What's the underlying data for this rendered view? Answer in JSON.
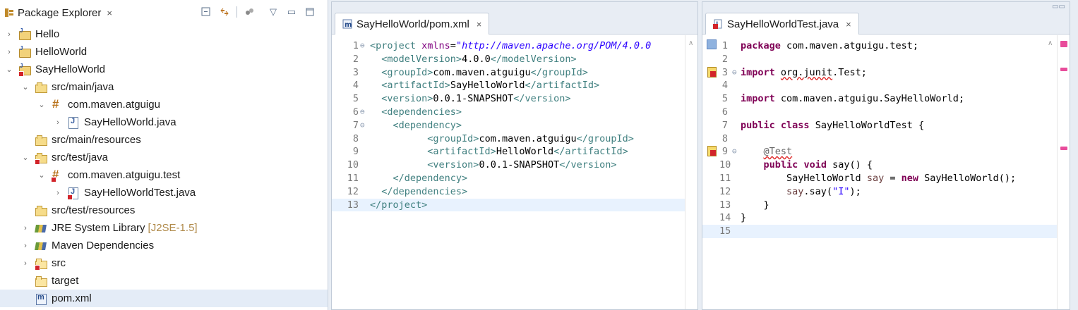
{
  "package_explorer": {
    "title": "Package Explorer",
    "close_icon": "×",
    "tools": [
      "collapse-all-icon",
      "link-with-editor-icon",
      "view-menu-icon",
      "minimize-icon",
      "maximize-icon"
    ],
    "items": [
      {
        "label": "Hello",
        "suffix": "",
        "indent": 0,
        "arrow": "›",
        "icon": "project-icon",
        "error": false
      },
      {
        "label": "HelloWorld",
        "suffix": "",
        "indent": 0,
        "arrow": "›",
        "icon": "project-icon",
        "error": false
      },
      {
        "label": "SayHelloWorld",
        "suffix": "",
        "indent": 0,
        "arrow": "⌄",
        "icon": "project-icon",
        "error": true
      },
      {
        "label": "src/main/java",
        "suffix": "",
        "indent": 1,
        "arrow": "⌄",
        "icon": "source-folder-icon",
        "error": false
      },
      {
        "label": "com.maven.atguigu",
        "suffix": "",
        "indent": 2,
        "arrow": "⌄",
        "icon": "package-icon",
        "error": false
      },
      {
        "label": "SayHelloWorld.java",
        "suffix": "",
        "indent": 3,
        "arrow": "›",
        "icon": "java-file-icon",
        "error": false
      },
      {
        "label": "src/main/resources",
        "suffix": "",
        "indent": 1,
        "arrow": "",
        "icon": "source-folder-icon",
        "error": false
      },
      {
        "label": "src/test/java",
        "suffix": "",
        "indent": 1,
        "arrow": "⌄",
        "icon": "source-folder-icon",
        "error": true
      },
      {
        "label": "com.maven.atguigu.test",
        "suffix": "",
        "indent": 2,
        "arrow": "⌄",
        "icon": "package-icon",
        "error": true
      },
      {
        "label": "SayHelloWorldTest.java",
        "suffix": "",
        "indent": 3,
        "arrow": "›",
        "icon": "java-file-icon",
        "error": true
      },
      {
        "label": "src/test/resources",
        "suffix": "",
        "indent": 1,
        "arrow": "",
        "icon": "source-folder-icon",
        "error": false
      },
      {
        "label": "JRE System Library",
        "suffix": "[J2SE-1.5]",
        "indent": 1,
        "arrow": "›",
        "icon": "library-icon",
        "error": false
      },
      {
        "label": "Maven Dependencies",
        "suffix": "",
        "indent": 1,
        "arrow": "›",
        "icon": "library-icon",
        "error": false
      },
      {
        "label": "src",
        "suffix": "",
        "indent": 1,
        "arrow": "›",
        "icon": "folder-icon",
        "error": true
      },
      {
        "label": "target",
        "suffix": "",
        "indent": 1,
        "arrow": "",
        "icon": "folder-icon",
        "error": false
      },
      {
        "label": "pom.xml",
        "suffix": "",
        "indent": 1,
        "arrow": "",
        "icon": "xml-file-icon",
        "error": false
      }
    ]
  },
  "pom_editor": {
    "tab_label": "SayHelloWorld/pom.xml",
    "tab_close": "×",
    "lines": [
      {
        "n": "1",
        "fold": "⊖",
        "html": "<span class='tag'>&lt;project </span><span class='attr'>xmlns</span><span class='plain'>=</span><span class='str'>\"http://maven.apache.org/POM/4.0.0</span>"
      },
      {
        "n": "2",
        "fold": "",
        "html": "  <span class='tag'>&lt;modelVersion&gt;</span><span class='plain'>4.0.0</span><span class='tag'>&lt;/modelVersion&gt;</span>"
      },
      {
        "n": "3",
        "fold": "",
        "html": "  <span class='tag'>&lt;groupId&gt;</span><span class='plain'>com.maven.atguigu</span><span class='tag'>&lt;/groupId&gt;</span>"
      },
      {
        "n": "4",
        "fold": "",
        "html": "  <span class='tag'>&lt;artifactId&gt;</span><span class='plain'>SayHelloWorld</span><span class='tag'>&lt;/artifactId&gt;</span>"
      },
      {
        "n": "5",
        "fold": "",
        "html": "  <span class='tag'>&lt;version&gt;</span><span class='plain'>0.0.1-SNAPSHOT</span><span class='tag'>&lt;/version&gt;</span>"
      },
      {
        "n": "6",
        "fold": "⊖",
        "html": "  <span class='tag'>&lt;dependencies&gt;</span>"
      },
      {
        "n": "7",
        "fold": "⊖",
        "html": "    <span class='tag'>&lt;dependency&gt;</span>"
      },
      {
        "n": "8",
        "fold": "",
        "html": "          <span class='tag'>&lt;groupId&gt;</span><span class='plain'>com.maven.atguigu</span><span class='tag'>&lt;/groupId&gt;</span>"
      },
      {
        "n": "9",
        "fold": "",
        "html": "          <span class='tag'>&lt;artifactId&gt;</span><span class='plain'>HelloWorld</span><span class='tag'>&lt;/artifactId&gt;</span>"
      },
      {
        "n": "10",
        "fold": "",
        "html": "          <span class='tag'>&lt;version&gt;</span><span class='plain'>0.0.1-SNAPSHOT</span><span class='tag'>&lt;/version&gt;</span>"
      },
      {
        "n": "11",
        "fold": "",
        "html": "    <span class='tag'>&lt;/dependency&gt;</span>"
      },
      {
        "n": "12",
        "fold": "",
        "html": "  <span class='tag'>&lt;/dependencies&gt;</span>"
      },
      {
        "n": "13",
        "fold": "",
        "html": "<span class='tag'>&lt;/project&gt;</span>"
      }
    ]
  },
  "java_editor": {
    "tab_label": "SayHelloWorldTest.java",
    "tab_close": "×",
    "lines": [
      {
        "n": "1",
        "fold": "",
        "html": "<span class='kw'>package</span> com.maven.atguigu.test;"
      },
      {
        "n": "2",
        "fold": "",
        "html": ""
      },
      {
        "n": "3",
        "fold": "⊖",
        "html": "<span class='kw'>import</span> <span class='wavy'>org.junit</span>.Test;"
      },
      {
        "n": "4",
        "fold": "",
        "html": ""
      },
      {
        "n": "5",
        "fold": "",
        "html": "<span class='kw'>import</span> com.maven.atguigu.SayHelloWorld;"
      },
      {
        "n": "6",
        "fold": "",
        "html": ""
      },
      {
        "n": "7",
        "fold": "",
        "html": "<span class='kw'>public</span> <span class='kw'>class</span> SayHelloWorldTest {"
      },
      {
        "n": "8",
        "fold": "",
        "html": ""
      },
      {
        "n": "9",
        "fold": "⊖",
        "html": "    <span class='ann'>@Test</span>"
      },
      {
        "n": "10",
        "fold": "",
        "html": "    <span class='kw'>public</span> <span class='kw'>void</span> say() {"
      },
      {
        "n": "11",
        "fold": "",
        "html": "        SayHelloWorld <span class='var'>say</span> = <span class='kw'>new</span> SayHelloWorld();"
      },
      {
        "n": "12",
        "fold": "",
        "html": "        <span class='var'>say</span>.say(<span class='s2'>\"I\"</span>);"
      },
      {
        "n": "13",
        "fold": "",
        "html": "    }"
      },
      {
        "n": "14",
        "fold": "",
        "html": "}"
      },
      {
        "n": "15",
        "fold": "",
        "html": ""
      }
    ]
  }
}
